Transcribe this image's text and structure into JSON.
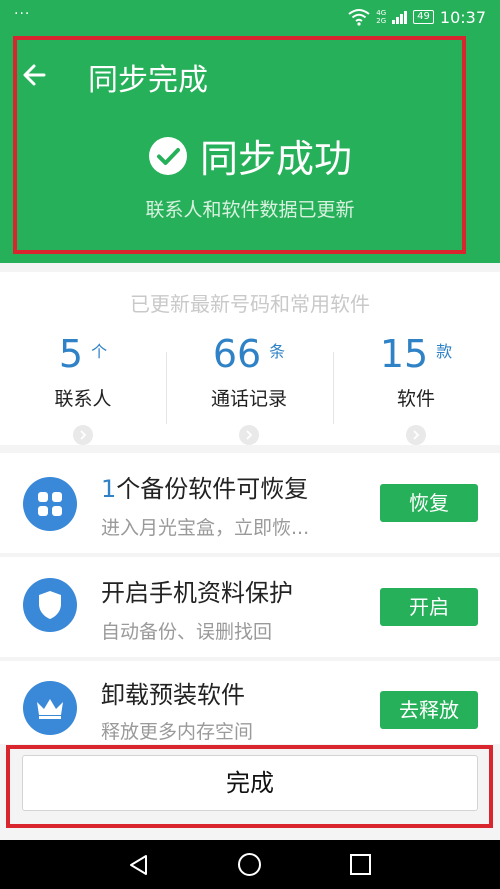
{
  "status_bar": {
    "dots": "···",
    "net_top": "4G",
    "net_bottom": "2G",
    "battery": "49",
    "time": "10:37"
  },
  "header": {
    "title": "同步完成",
    "success_text": "同步成功",
    "subtitle": "联系人和软件数据已更新"
  },
  "stats": {
    "header": "已更新最新号码和常用软件",
    "items": [
      {
        "value": "5",
        "unit": "个",
        "label": "联系人"
      },
      {
        "value": "66",
        "unit": "条",
        "label": "通话记录"
      },
      {
        "value": "15",
        "unit": "款",
        "label": "软件"
      }
    ]
  },
  "list": [
    {
      "title_accent": "1",
      "title": "个备份软件可恢复",
      "subtitle": "进入月光宝盒，立即恢...",
      "action": "恢复",
      "icon": "apps-grid-icon"
    },
    {
      "title_accent": "",
      "title": "开启手机资料保护",
      "subtitle": "自动备份、误删找回",
      "action": "开启",
      "icon": "shield-icon"
    },
    {
      "title_accent": "",
      "title": "卸载预装软件",
      "subtitle": "释放更多内存空间",
      "action": "去释放",
      "icon": "crown-icon"
    }
  ],
  "done_button": "完成",
  "colors": {
    "primary_green": "#27b05a",
    "accent_blue": "#2f82c6",
    "highlight_red": "#d9262e"
  }
}
